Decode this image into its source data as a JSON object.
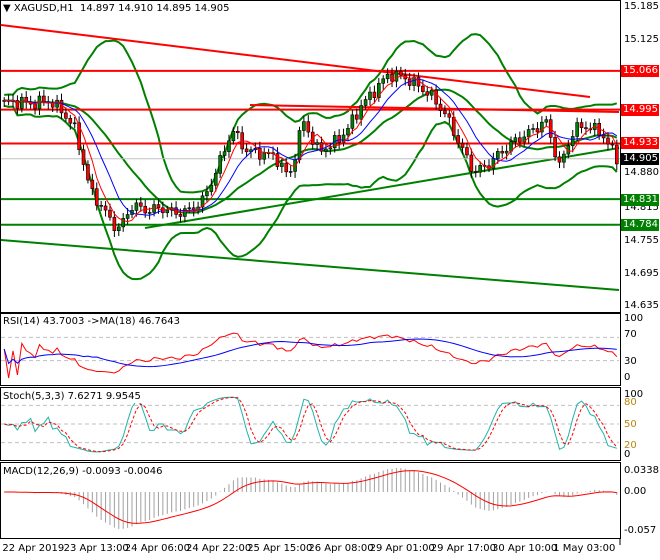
{
  "header": {
    "symbol": "XAGUSD,H1",
    "open": "14.897",
    "high": "14.910",
    "low": "14.895",
    "close": "14.905"
  },
  "colors": {
    "bull": "#008000",
    "bear": "#ff0000",
    "band": "#008000",
    "red_line": "#ff0000",
    "green_line": "#008000",
    "ma_fast": "#ff0000",
    "ma_slow": "#0000ff"
  },
  "price_axis": [
    "15.185",
    "15.125",
    "14.880",
    "14.815",
    "14.755",
    "14.695",
    "14.635"
  ],
  "levels": {
    "r1": {
      "label": "15.066",
      "price": 15.066
    },
    "r2": {
      "label": "14.995",
      "price": 14.995
    },
    "r3": {
      "label": "14.933",
      "price": 14.933
    },
    "current": {
      "label": "14.905",
      "price": 14.905
    },
    "s1": {
      "label": "14.831",
      "price": 14.831
    },
    "s2": {
      "label": "14.784",
      "price": 14.784
    }
  },
  "rsi": {
    "title": "RSI(14) 43.7003  ->MA(18) 46.7643",
    "axis": [
      "100",
      "70",
      "30",
      "0"
    ]
  },
  "stoch": {
    "title": "Stoch(5,3,3) 7.6271 9.9545",
    "axis": [
      "100",
      "80",
      "50",
      "20",
      "0"
    ]
  },
  "macd": {
    "title": "MACD(12,26,9) -0.0093 -0.0046",
    "axis": [
      "0.0338",
      "0.00",
      "-0.057"
    ]
  },
  "time_axis": [
    "22 Apr 2019",
    "23 Apr 13:00",
    "24 Apr 06:00",
    "24 Apr 22:00",
    "25 Apr 15:00",
    "26 Apr 08:00",
    "29 Apr 01:00",
    "29 Apr 17:00",
    "30 Apr 10:00",
    "1 May 03:00"
  ],
  "chart_data": {
    "type": "candlestick",
    "symbol": "XAGUSD",
    "timeframe": "H1",
    "ylim": [
      14.635,
      15.185
    ],
    "close_anchors": [
      15.007,
      15.01,
      15.005,
      15.012,
      14.995,
      14.958,
      14.85,
      14.81,
      14.774,
      14.82,
      14.81,
      14.815,
      14.805,
      14.81,
      14.83,
      14.89,
      14.958,
      14.92,
      14.915,
      14.91,
      14.87,
      14.975,
      14.92,
      14.93,
      14.955,
      15.0,
      15.03,
      15.06,
      15.055,
      15.04,
      15.02,
      14.985,
      14.93,
      14.88,
      14.895,
      14.92,
      14.94,
      14.955,
      14.975,
      14.89,
      14.96,
      14.965,
      14.95,
      14.905
    ]
  }
}
